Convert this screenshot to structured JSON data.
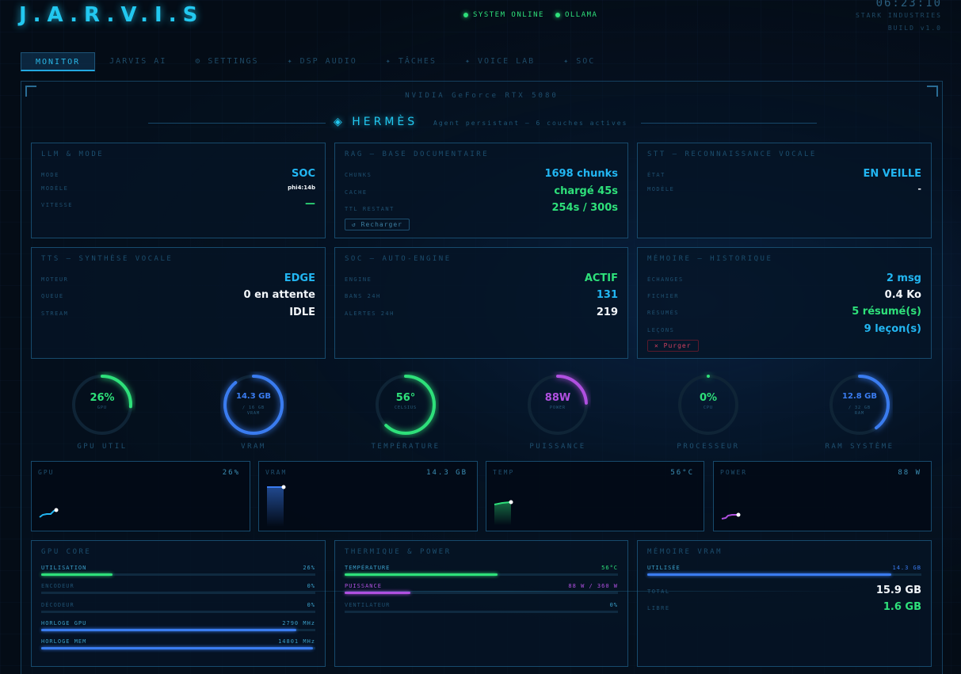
{
  "app": {
    "logo": "J.A.R.V.I.S",
    "status": [
      "SYSTEM ONLINE",
      "OLLAMA"
    ],
    "clock": "06:23:10",
    "company": "STARK INDUSTRIES",
    "build": "BUILD v1.0"
  },
  "tabs": [
    {
      "label": "MONITOR",
      "active": true
    },
    {
      "label": "JARVIS AI"
    },
    {
      "label": "⚙ SETTINGS"
    },
    {
      "label": "✦ DSP AUDIO"
    },
    {
      "label": "✦ TÂCHES"
    },
    {
      "label": "✦ VOICE LAB"
    },
    {
      "label": "✦ SOC"
    }
  ],
  "gpu_name": "NVIDIA GeForce RTX 5080",
  "hermes": {
    "title": "◈ HERMÈS",
    "subtitle": "Agent persistant — 6 couches actives"
  },
  "cards": {
    "llm": {
      "title": "LLM & MODE",
      "rows": [
        {
          "k": "MODE",
          "v": "SOC"
        },
        {
          "k": "MODÈLE",
          "v": "phi4:14b"
        },
        {
          "k": "VITESSE",
          "v": "—"
        }
      ]
    },
    "rag": {
      "title": "RAG — BASE DOCUMENTAIRE",
      "rows": [
        {
          "k": "CHUNKS",
          "v": "1698 chunks"
        },
        {
          "k": "CACHE",
          "v": "chargé 45s"
        },
        {
          "k": "TTL RESTANT",
          "v": "254s / 300s"
        }
      ],
      "button": "↺ Recharger"
    },
    "stt": {
      "title": "STT — RECONNAISSANCE VOCALE",
      "rows": [
        {
          "k": "ÉTAT",
          "v": "EN VEILLE"
        },
        {
          "k": "MODÈLE",
          "v": "-"
        }
      ]
    },
    "tts": {
      "title": "TTS — SYNTHÈSE VOCALE",
      "rows": [
        {
          "k": "MOTEUR",
          "v": "EDGE"
        },
        {
          "k": "QUEUE",
          "v": "0 en attente"
        },
        {
          "k": "STREAM",
          "v": "IDLE"
        }
      ]
    },
    "soc": {
      "title": "SOC — AUTO-ENGINE",
      "rows": [
        {
          "k": "ENGINE",
          "v": "ACTIF"
        },
        {
          "k": "BANS 24H",
          "v": "131"
        },
        {
          "k": "ALERTES 24H",
          "v": "219"
        }
      ]
    },
    "memory": {
      "title": "MÉMOIRE — HISTORIQUE",
      "rows": [
        {
          "k": "ÉCHANGES",
          "v": "2 msg"
        },
        {
          "k": "FICHIER",
          "v": "0.4 Ko"
        },
        {
          "k": "RÉSUMÉS",
          "v": "5 résumé(s)"
        },
        {
          "k": "LEÇONS",
          "v": "9 leçon(s)"
        }
      ],
      "button": "✕ Purger"
    }
  },
  "gauges": [
    {
      "value": "26%",
      "sub": "GPU",
      "sub2": "",
      "label": "GPU UTIL",
      "fraction": 0.26,
      "color": "#2ee07a"
    },
    {
      "value": "14.3 GB",
      "sub": "/ 16 GB",
      "sub2": "VRAM",
      "label": "VRAM",
      "fraction": 0.89,
      "color": "#3a7cf0"
    },
    {
      "value": "56°",
      "sub": "CELSIUS",
      "sub2": "",
      "label": "TEMPÉRATURE",
      "fraction": 0.62,
      "color": "#2ee07a"
    },
    {
      "value": "88W",
      "sub": "POWER",
      "sub2": "",
      "label": "PUISSANCE",
      "fraction": 0.24,
      "color": "#b050e0"
    },
    {
      "value": "0%",
      "sub": "CPU",
      "sub2": "",
      "label": "PROCESSEUR",
      "fraction": 0.0,
      "color": "#2ee07a"
    },
    {
      "value": "12.8 GB",
      "sub": "/ 32 GB",
      "sub2": "RAM",
      "label": "RAM SYSTÈME",
      "fraction": 0.4,
      "color": "#3a7cf0"
    }
  ],
  "sparks": [
    {
      "title": "GPU",
      "value": "26%",
      "color": "#22b6f2"
    },
    {
      "title": "VRAM",
      "value": "14.3 GB",
      "color": "#3a7cf0"
    },
    {
      "title": "TEMP",
      "value": "56°C",
      "color": "#2ee07a"
    },
    {
      "title": "POWER",
      "value": "88 W",
      "color": "#b050e0"
    }
  ],
  "gpu_core": {
    "title": "GPU CORE",
    "bars": [
      {
        "k": "UTILISATION",
        "v": "26%",
        "fraction": 0.26,
        "color": "#2ee07a",
        "kcolor": "#3a9ec8"
      },
      {
        "k": "ENCODEUR",
        "v": "0%",
        "fraction": 0.0,
        "color": "#2ee07a",
        "kcolor": "#1f5070"
      },
      {
        "k": "DÉCODEUR",
        "v": "0%",
        "fraction": 0.0,
        "color": "#2ee07a",
        "kcolor": "#1f5070"
      },
      {
        "k": "HORLOGE GPU",
        "v": "2790 MHz",
        "fraction": 0.93,
        "color": "#3a7cf0",
        "kcolor": "#3a9ec8"
      },
      {
        "k": "HORLOGE MEM",
        "v": "14801 MHz",
        "fraction": 0.99,
        "color": "#3a7cf0",
        "kcolor": "#3a9ec8"
      }
    ]
  },
  "thermal": {
    "title": "THERMIQUE & POWER",
    "bars": [
      {
        "k": "TEMPÉRATURE",
        "v": "56°C",
        "fraction": 0.56,
        "color": "#2ee07a",
        "kcolor": "#3a9ec8",
        "vcolor": "#2ee07a"
      },
      {
        "k": "PUISSANCE",
        "v": "88 W / 360 W",
        "fraction": 0.24,
        "color": "#b050e0",
        "kcolor": "#b050e0",
        "vcolor": "#b050e0"
      },
      {
        "k": "VENTILATEUR",
        "v": "0%",
        "fraction": 0.0,
        "color": "#2ee07a",
        "kcolor": "#1f5070",
        "vcolor": "#3a9ec8"
      }
    ]
  },
  "vram_mem": {
    "title": "MÉMOIRE VRAM",
    "used": {
      "k": "UTILISÉE",
      "v": "14.3 GB",
      "fraction": 0.89,
      "color": "#3a7cf0"
    },
    "rows": [
      {
        "k": "TOTAL",
        "v": "15.9 GB"
      },
      {
        "k": "LIBRE",
        "v": "1.6 GB"
      }
    ]
  }
}
